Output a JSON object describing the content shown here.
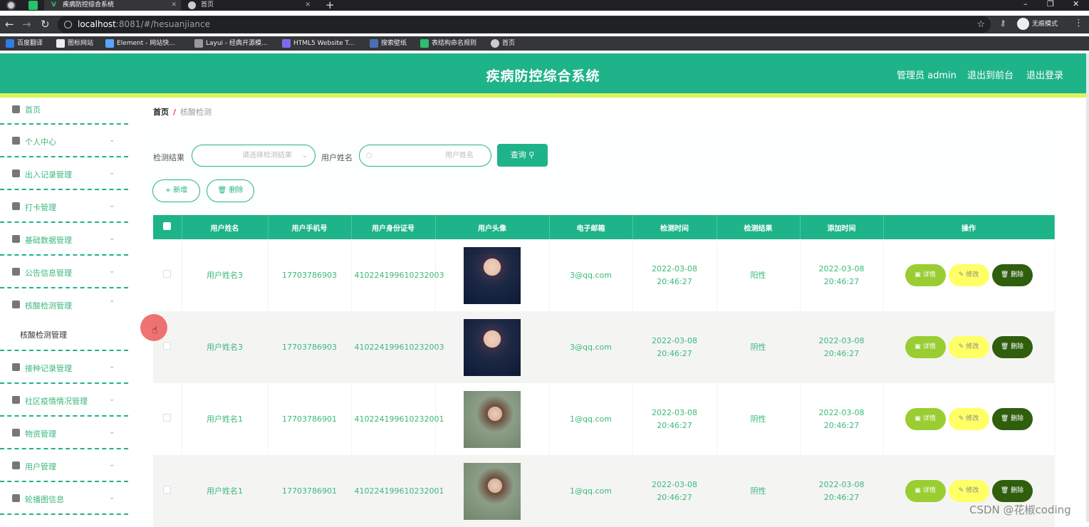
{
  "browser": {
    "tabs": [
      {
        "title": "疾病防控综合系统"
      },
      {
        "title": "首页"
      }
    ],
    "new_tab": "+",
    "url_host": "localhost",
    "url_rest": ":8081/#/hesuanjiance",
    "incognito_label": "无痕模式",
    "bookmarks": [
      "百度翻译",
      "图标网站",
      "Element - 网站快...",
      "Layui - 经典开源模...",
      "HTML5 Website T...",
      "搜索壁纸",
      "表结构命名规则",
      "首页"
    ]
  },
  "header": {
    "title": "疾病防控综合系统",
    "admin": "管理员 admin",
    "back_front": "退出到前台",
    "logout": "退出登录"
  },
  "sidebar": {
    "items": [
      {
        "label": "首页",
        "icon": "home-icon"
      },
      {
        "label": "个人中心",
        "icon": "user-icon"
      },
      {
        "label": "出入记录管理",
        "icon": "send-icon"
      },
      {
        "label": "打卡管理",
        "icon": "briefcase-icon"
      },
      {
        "label": "基础数据管理",
        "icon": "clipboard-icon"
      },
      {
        "label": "公告信息管理",
        "icon": "copy-icon"
      },
      {
        "label": "核酸检测管理",
        "icon": "bar-chart-icon"
      },
      {
        "label": "接种记录管理",
        "icon": "crop-icon"
      },
      {
        "label": "社区疫情情况管理",
        "icon": "edit-icon"
      },
      {
        "label": "物资管理",
        "icon": "box-icon"
      },
      {
        "label": "用户管理",
        "icon": "trash-icon"
      },
      {
        "label": "轮播图信息",
        "icon": "sliders-icon"
      }
    ],
    "sub_item": "核酸检测管理"
  },
  "breadcrumb": {
    "home": "首页",
    "sep": "/",
    "current": "核酸检测"
  },
  "filters": {
    "result_label": "检测结果",
    "result_placeholder": "请选择检测结果",
    "name_label": "用户姓名",
    "name_placeholder": "用户姓名",
    "query_button": "查询"
  },
  "actions": {
    "add": "新增",
    "delete": "删除"
  },
  "table": {
    "columns": [
      "用户姓名",
      "用户手机号",
      "用户身份证号",
      "用户头像",
      "电子邮箱",
      "检测时间",
      "检测结果",
      "添加时间",
      "操作"
    ],
    "rows": [
      {
        "name": "用户姓名3",
        "phone": "17703786903",
        "id_card": "410224199610232003",
        "avatar": "boy",
        "email": "3@qq.com",
        "test_time": "2022-03-08 20:46:27",
        "result": "阳性",
        "add_time": "2022-03-08 20:46:27"
      },
      {
        "name": "用户姓名3",
        "phone": "17703786903",
        "id_card": "410224199610232003",
        "avatar": "boy",
        "email": "3@qq.com",
        "test_time": "2022-03-08 20:46:27",
        "result": "阴性",
        "add_time": "2022-03-08 20:46:27"
      },
      {
        "name": "用户姓名1",
        "phone": "17703786901",
        "id_card": "410224199610232001",
        "avatar": "girl",
        "email": "1@qq.com",
        "test_time": "2022-03-08 20:46:27",
        "result": "阴性",
        "add_time": "2022-03-08 20:46:27"
      },
      {
        "name": "用户姓名1",
        "phone": "17703786901",
        "id_card": "410224199610232001",
        "avatar": "girl",
        "email": "1@qq.com",
        "test_time": "2022-03-08 20:46:27",
        "result": "阴性",
        "add_time": "2022-03-08 20:46:27"
      }
    ],
    "op_labels": {
      "detail": "详情",
      "edit": "修改",
      "delete": "删除"
    }
  },
  "watermark": "CSDN @花椒coding",
  "colors": {
    "primary": "#1fb38a",
    "accent_bar": "#d9f55b",
    "detail": "#9acd32",
    "edit": "#ffff66",
    "delete": "#2f5e0d"
  }
}
